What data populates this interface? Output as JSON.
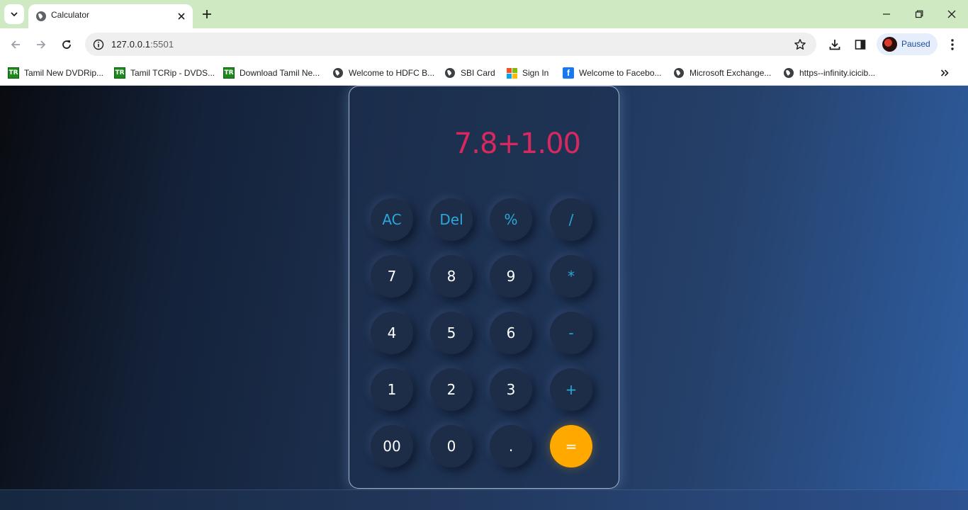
{
  "tab": {
    "title": "Calculator"
  },
  "address": {
    "host": "127.0.0.1",
    "port": ":5501"
  },
  "profile": {
    "label": "Paused"
  },
  "bookmarks": [
    {
      "label": "Tamil New DVDRip...",
      "icon": "tr-icon"
    },
    {
      "label": "Tamil TCRip - DVDS...",
      "icon": "tr-icon"
    },
    {
      "label": "Download Tamil Ne...",
      "icon": "tr-icon"
    },
    {
      "label": "Welcome to HDFC B...",
      "icon": "globe-icon"
    },
    {
      "label": "SBI Card",
      "icon": "globe-icon"
    },
    {
      "label": "Sign In",
      "icon": "microsoft-icon"
    },
    {
      "label": "Welcome to Facebo...",
      "icon": "facebook-icon"
    },
    {
      "label": "Microsoft Exchange...",
      "icon": "globe-icon"
    },
    {
      "label": "https--infinity.icicib...",
      "icon": "globe-icon"
    }
  ],
  "calculator": {
    "display": "7.8+1.00",
    "keys": {
      "ac": "AC",
      "del": "Del",
      "percent": "%",
      "divide": "/",
      "seven": "7",
      "eight": "8",
      "nine": "9",
      "multiply": "*",
      "four": "4",
      "five": "5",
      "six": "6",
      "minus": "-",
      "one": "1",
      "two": "2",
      "three": "3",
      "plus": "+",
      "double_zero": "00",
      "zero": "0",
      "dot": ".",
      "equals": "="
    }
  },
  "colors": {
    "display_text": "#d8285f",
    "operator_text": "#2ba7d8",
    "equals_bg": "#ffa800",
    "tabstrip_bg": "#cfe9c3"
  }
}
